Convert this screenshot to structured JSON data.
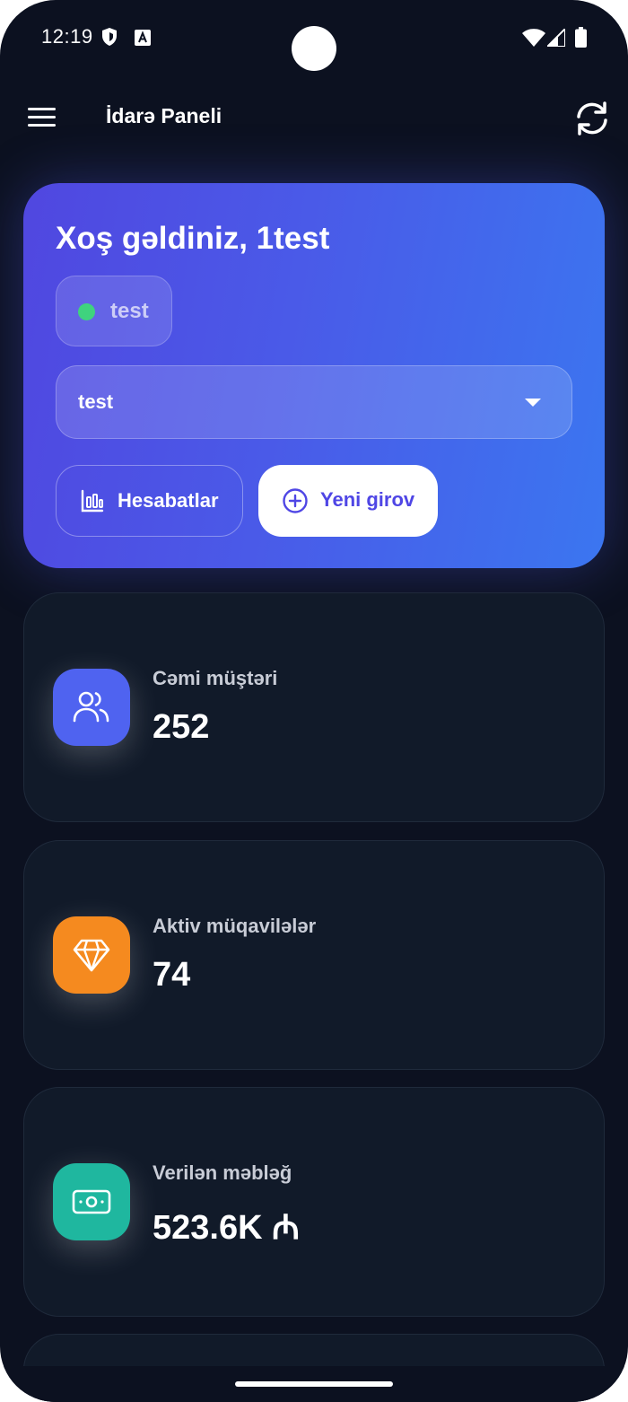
{
  "status_bar": {
    "time": "12:19"
  },
  "app_bar": {
    "title": "İdarə Paneli",
    "menu_icon": "menu-icon",
    "refresh_icon": "refresh-icon"
  },
  "hero": {
    "welcome": "Xoş gəldiniz, 1test",
    "status_chip": {
      "label": "test",
      "dot_color": "#3fd37e"
    },
    "select": {
      "value": "test"
    },
    "reports_button": {
      "label": "Hesabatlar",
      "icon": "bar-chart-icon"
    },
    "new_pledge_button": {
      "label": "Yeni girov",
      "icon": "plus-circle-icon"
    },
    "gradient": [
      "#5047e0",
      "#3b76f0"
    ]
  },
  "stats": [
    {
      "label": "Cəmi müştəri",
      "value": "252",
      "icon": "users-icon",
      "color": "#4f63f0"
    },
    {
      "label": "Aktiv müqavilələr",
      "value": "74",
      "icon": "diamond-icon",
      "color": "#f58a1f"
    },
    {
      "label": "Verilən məbləğ",
      "value": "523.6K ₼",
      "icon": "cash-icon",
      "color": "#1fb79f"
    }
  ]
}
